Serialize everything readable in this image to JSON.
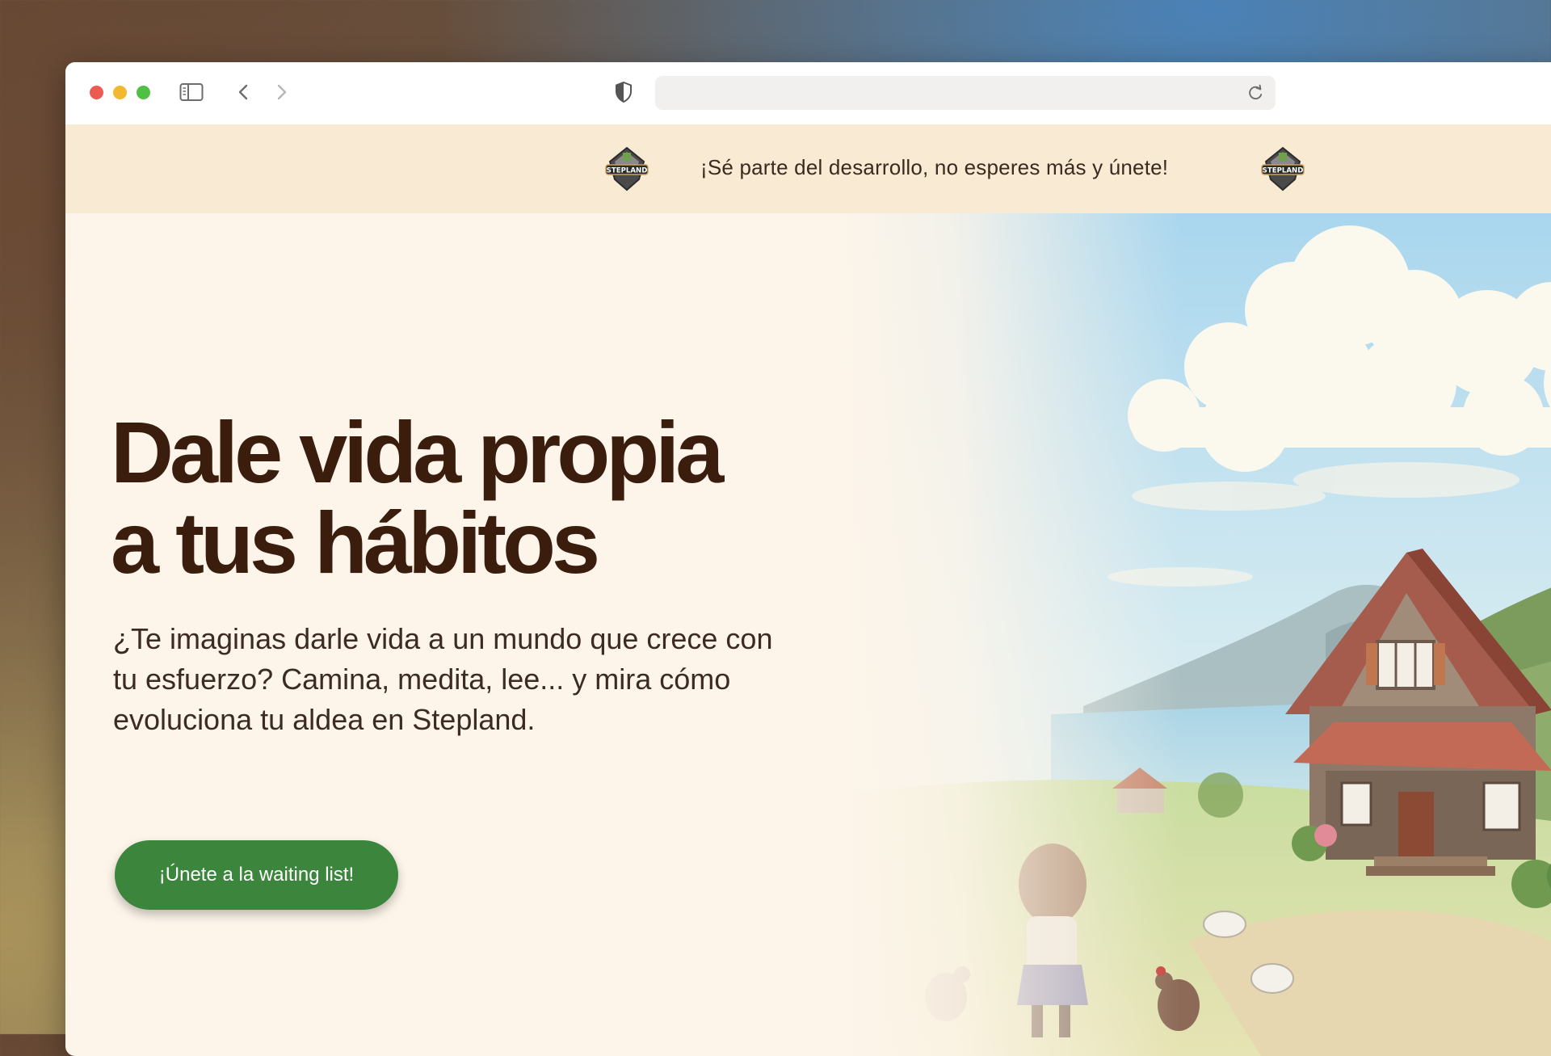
{
  "browser": {
    "url": "",
    "icons": [
      "sidebar-icon",
      "back-icon",
      "forward-icon",
      "shield-icon",
      "reload-icon"
    ]
  },
  "banner": {
    "text": "¡Sé parte del desarrollo, no esperes más y únete!",
    "logo_text": "STEPLAND"
  },
  "hero": {
    "headline_line1": "Dale vida propia",
    "headline_line2": "a tus hábitos",
    "subtitle": "¿Te imaginas darle vida a un mundo que crece con tu esfuerzo? Camina, medita, lee... y mira cómo evoluciona tu aldea en Stepland.",
    "cta_label": "¡Únete a la waiting list!"
  },
  "colors": {
    "page_bg": "#fdf5ea",
    "banner_bg": "#f8ead3",
    "headline": "#3a1d0d",
    "cta_bg": "#3b853d"
  }
}
